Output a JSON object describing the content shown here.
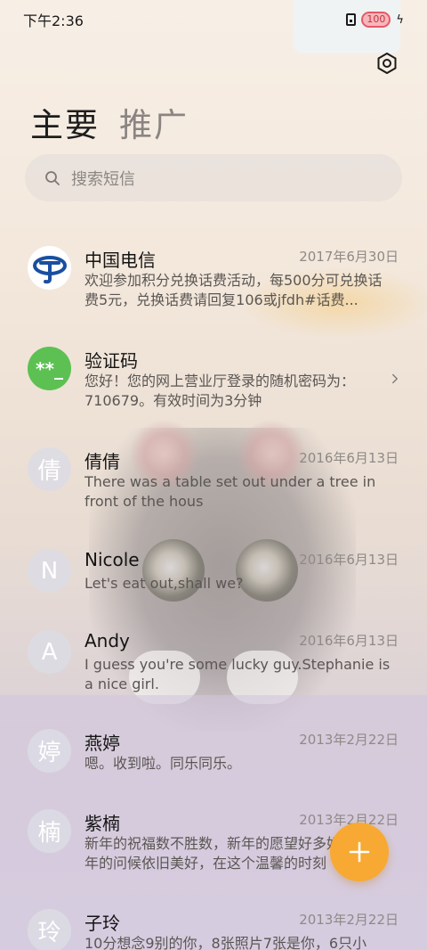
{
  "status_bar": {
    "time": "下午2:36",
    "battery": "100"
  },
  "tabs": [
    {
      "label": "主要"
    },
    {
      "label": "推广"
    }
  ],
  "search": {
    "placeholder": "搜索短信"
  },
  "messages": [
    {
      "name": "中国电信",
      "date": "2017年6月30日",
      "preview": "欢迎参加积分兑换话费活动，每500分可兑换话费5元，兑换话费请回复106或jfdh#话费...",
      "avatar": "telecom-logo"
    },
    {
      "name": "验证码",
      "date": "",
      "preview": "您好！您的网上营业厅登录的随机密码为：710679。有效时间为3分钟",
      "avatar_text": "**_"
    },
    {
      "name": "倩倩",
      "date": "2016年6月13日",
      "preview": "There was a table set out under a tree in front of the hous",
      "avatar_text": "倩"
    },
    {
      "name": "Nicole",
      "date": "2016年6月13日",
      "preview": "Let's eat out,shall we?",
      "avatar_text": "N"
    },
    {
      "name": "Andy",
      "date": "2016年6月13日",
      "preview": "I guess you're some lucky guy.Stephanie is a nice girl.",
      "avatar_text": "A"
    },
    {
      "name": "燕婷",
      "date": "2013年2月22日",
      "preview": "嗯。收到啦。同乐同乐。",
      "avatar_text": "婷"
    },
    {
      "name": "紫楠",
      "date": "2013年2月22日",
      "preview": "新年的祝福数不胜数，新年的愿望好多好多，新年的问候依旧美好，在这个温馨的时刻",
      "avatar_text": "楠"
    },
    {
      "name": "子玲",
      "date": "2013年2月22日",
      "preview": "10分想念9别的你，8张照片7张是你，6只小",
      "avatar_text": "玲"
    }
  ],
  "colors": {
    "fab": "#f7a933",
    "verify_avatar": "#5cc152",
    "telecom_blue": "#1a4fa0"
  },
  "icons": {
    "settings": "settings-icon",
    "search": "search-icon",
    "compose": "plus-icon",
    "chevron": "chevron-right-icon"
  }
}
